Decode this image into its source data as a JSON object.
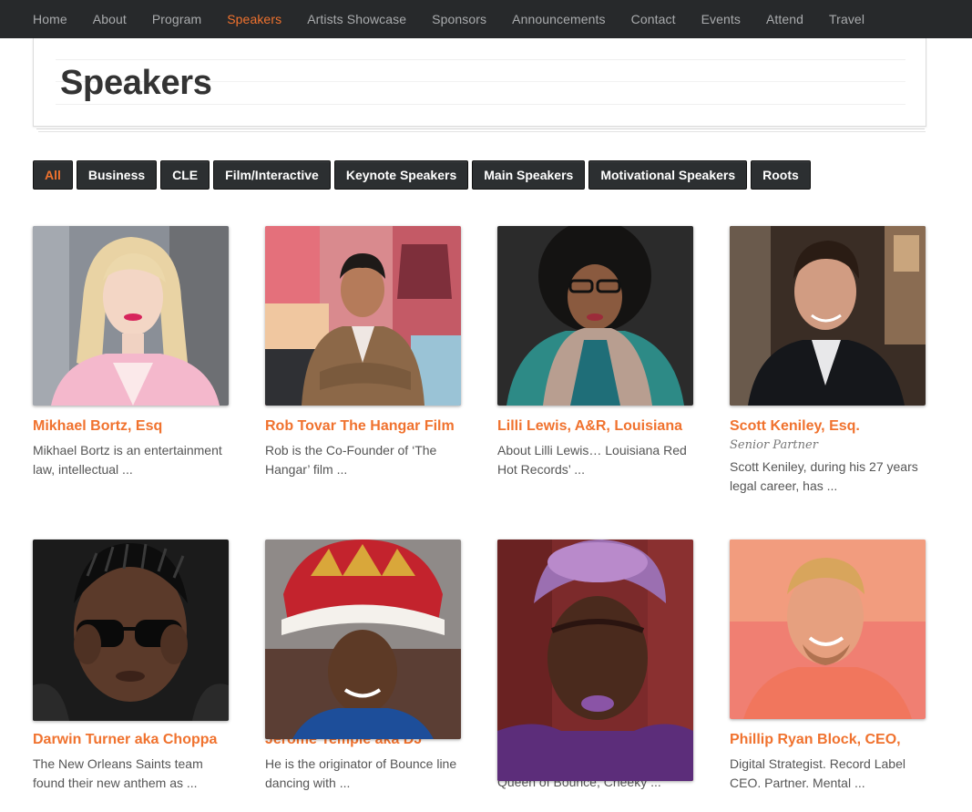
{
  "nav": {
    "items": [
      "Home",
      "About",
      "Program",
      "Speakers",
      "Artists Showcase",
      "Sponsors",
      "Announcements",
      "Contact",
      "Events",
      "Attend",
      "Travel"
    ],
    "active_index": 3
  },
  "page": {
    "title": "Speakers"
  },
  "filters": {
    "items": [
      "All",
      "Business",
      "CLE",
      "Film/Interactive",
      "Keynote Speakers",
      "Main Speakers",
      "Motivational Speakers",
      "Roots"
    ],
    "active_index": 0
  },
  "speakers": [
    {
      "name": "Mikhael Bortz, Esq",
      "role": "",
      "description": "Mikhael Bortz is an entertainment law, intellectual ...",
      "photo": "portrait-blonde-woman-pink-blazer"
    },
    {
      "name": "Rob Tovar The Hangar Film",
      "role": "",
      "description": "Rob is the Co-Founder of ‘The Hangar’ film ...",
      "photo": "portrait-man-tweed-jacket-mural"
    },
    {
      "name": "Lilli Lewis, A&R, Louisiana",
      "role": "",
      "description": "About Lilli Lewis… Louisiana Red Hot Records’ ...",
      "photo": "portrait-woman-afro-glasses-scarf"
    },
    {
      "name": "Scott Keniley, Esq.",
      "role": "Senior Partner",
      "description": "Scott Keniley, during his 27 years legal career, has ...",
      "photo": "portrait-man-dark-suit"
    },
    {
      "name": "Darwin Turner aka Choppa",
      "role": "",
      "description": "The New Orleans Saints team found their new anthem as ...",
      "photo": "portrait-man-sunglasses-braids"
    },
    {
      "name": "Jerome Temple aka DJ",
      "role": "",
      "description": "He is the originator of Bounce line dancing with ...",
      "photo": "portrait-man-crown"
    },
    {
      "name": "",
      "role": "",
      "description": "Queen of Bounce, Cheeky ...",
      "photo": "portrait-woman-purple-hair-throne"
    },
    {
      "name": "Phillip Ryan Block, CEO,",
      "role": "",
      "description": "Digital Strategist. Record Label CEO. Partner. Mental ...",
      "photo": "portrait-smiling-man-pink-background"
    }
  ],
  "colors": {
    "accent": "#f0722e",
    "nav_bg": "#27292b",
    "button_bg": "#2c2f31"
  }
}
